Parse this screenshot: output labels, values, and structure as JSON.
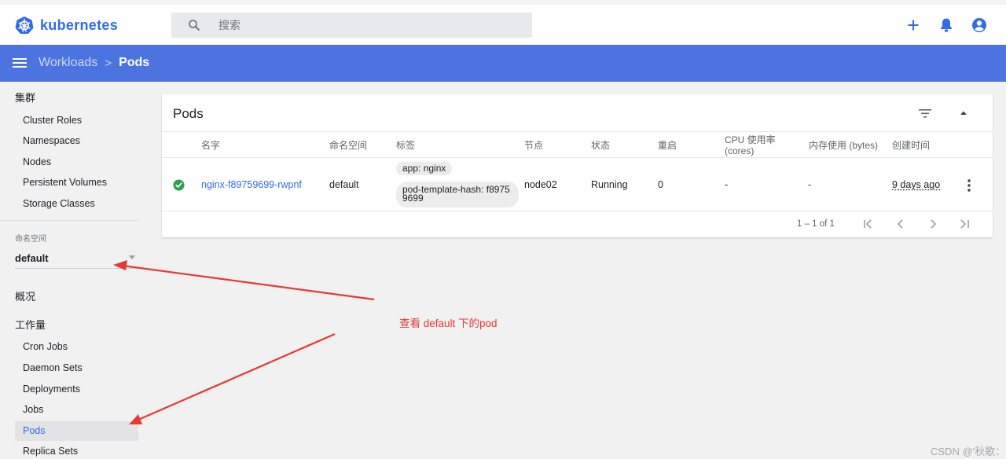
{
  "app": {
    "name": "kubernetes",
    "brand_color": "#326ce5",
    "appbar_color": "#4c74e0"
  },
  "search": {
    "placeholder": "搜索",
    "icon": "search-icon"
  },
  "top_actions": [
    {
      "name": "add-icon"
    },
    {
      "name": "bell-icon"
    },
    {
      "name": "account-icon"
    }
  ],
  "breadcrumb": {
    "parent": "Workloads",
    "separator": ">",
    "current": "Pods"
  },
  "sidebar": {
    "cluster_heading": "集群",
    "cluster_items": [
      {
        "label": "Cluster Roles"
      },
      {
        "label": "Namespaces"
      },
      {
        "label": "Nodes"
      },
      {
        "label": "Persistent Volumes"
      },
      {
        "label": "Storage Classes"
      }
    ],
    "namespace_label": "命名空间",
    "namespace_value": "default",
    "overview_heading": "概况",
    "workloads_heading": "工作量",
    "workload_items": [
      {
        "label": "Cron Jobs"
      },
      {
        "label": "Daemon Sets"
      },
      {
        "label": "Deployments"
      },
      {
        "label": "Jobs"
      },
      {
        "label": "Pods",
        "active": true
      },
      {
        "label": "Replica Sets"
      }
    ]
  },
  "pods_card": {
    "title": "Pods",
    "columns": [
      "名字",
      "命名空间",
      "标签",
      "节点",
      "状态",
      "重启",
      "CPU 使用率",
      "(cores)",
      "内存使用 (bytes)",
      "创建时间"
    ],
    "rows": [
      {
        "status_icon": "check-circle-icon",
        "status_color": "#2e9e4f",
        "name": "nginx-f89759699-rwpnf",
        "namespace": "default",
        "labels": [
          "app: nginx",
          "pod-template-hash: f8975",
          "9699"
        ],
        "node": "node02",
        "status": "Running",
        "restarts": "0",
        "cpu": "-",
        "memory": "-",
        "created": "9 days ago"
      }
    ],
    "pagination": {
      "range": "1 – 1 of 1"
    }
  },
  "annotation": {
    "text": "查看 default 下的pod",
    "color": "#e53935"
  },
  "watermark": "CSDN @'秋歌："
}
